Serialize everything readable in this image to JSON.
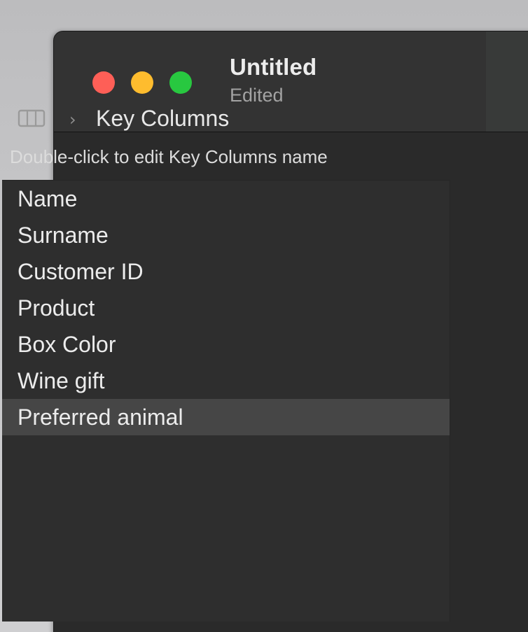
{
  "window": {
    "title": "Untitled",
    "subtitle": "Edited"
  },
  "toolbar": {
    "sidebar_icon": "sidebar-toggle-icon",
    "separator_icon": "chevron-right-icon",
    "breadcrumb": "Key Columns"
  },
  "hint": "Double-click to edit Key Columns name",
  "list": {
    "items": [
      {
        "label": "Name"
      },
      {
        "label": "Surname"
      },
      {
        "label": "Customer ID"
      },
      {
        "label": "Product"
      },
      {
        "label": "Box Color"
      },
      {
        "label": "Wine gift"
      },
      {
        "label": "Preferred animal"
      }
    ],
    "selected_item": "Preferred animal"
  },
  "colors": {
    "close": "#fe5f57",
    "minimize": "#febc2e",
    "zoom": "#28c840",
    "window_bg": "#2b2b2b",
    "selection": "#464646"
  }
}
